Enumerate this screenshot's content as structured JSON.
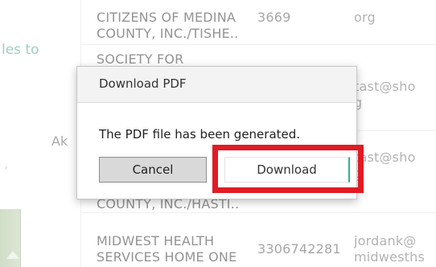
{
  "background": {
    "left_link_text": "les to",
    "left_partial_text": "Ak",
    "rows": [
      {
        "name_lines": [
          "CITIZENS OF MEDINA",
          "COUNTY, INC./TISHE.."
        ],
        "phone": "3669",
        "email_lines": [
          "org"
        ]
      },
      {
        "name_lines": [
          "SOCIETY FOR"
        ],
        "phone": "",
        "email_lines": [
          "tast@sho",
          "g"
        ]
      },
      {
        "name_lines": [],
        "phone": "",
        "email_lines": [
          "tast@sho",
          "g"
        ]
      },
      {
        "name_lines": [
          "COUNTY, INC./HASTI.."
        ],
        "phone": "",
        "email_lines": []
      },
      {
        "name_lines": [
          "MIDWEST HEALTH",
          "SERVICES HOME ONE"
        ],
        "phone": "3306742281",
        "email_lines": [
          "jordank@",
          "midwesths"
        ]
      }
    ]
  },
  "dialog": {
    "title": "Download PDF",
    "message": "The PDF file has been generated.",
    "cancel_label": "Cancel",
    "download_label": "Download"
  },
  "colors": {
    "highlight": "#e01b24",
    "accent": "#2fb38b",
    "link": "#3aa07a"
  }
}
